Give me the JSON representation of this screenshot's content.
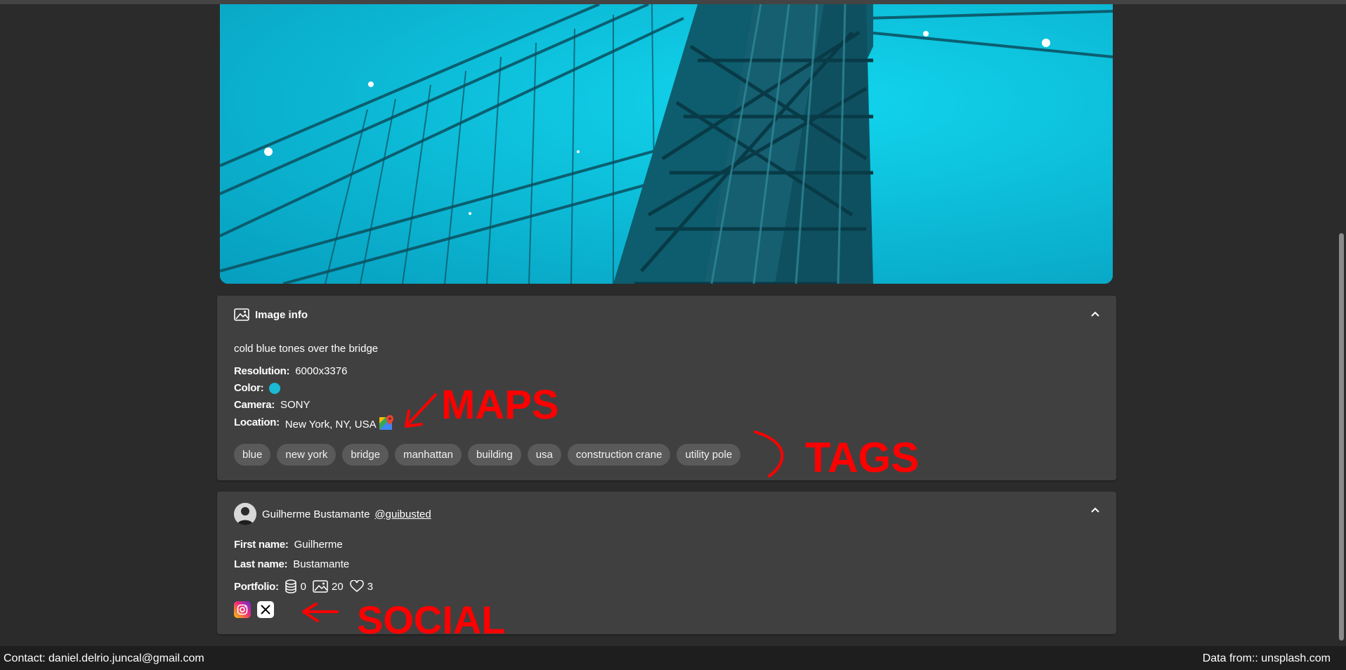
{
  "image_info": {
    "title": "Image info",
    "description": "cold blue tones over the bridge",
    "resolution_label": "Resolution:",
    "resolution": "6000x3376",
    "color_label": "Color:",
    "color_value": "#1ab9d4",
    "camera_label": "Camera:",
    "camera": "SONY",
    "location_label": "Location:",
    "location": "New York, NY, USA",
    "tags": [
      "blue",
      "new york",
      "bridge",
      "manhattan",
      "building",
      "usa",
      "construction crane",
      "utility pole"
    ]
  },
  "user": {
    "name": "Guilherme Bustamante",
    "handle": "@guibusted",
    "first_name_label": "First name:",
    "first_name": "Guilherme",
    "last_name_label": "Last name:",
    "last_name": "Bustamante",
    "portfolio_label": "Portfolio:",
    "collections": "0",
    "photos": "20",
    "likes": "3"
  },
  "annotations": {
    "maps": "MAPS",
    "tags": "TAGS",
    "social": "SOCIAL",
    "color": "#ff0000"
  },
  "footer": {
    "contact": "Contact: daniel.delrio.juncal@gmail.com",
    "source": "Data from:: unsplash.com"
  }
}
